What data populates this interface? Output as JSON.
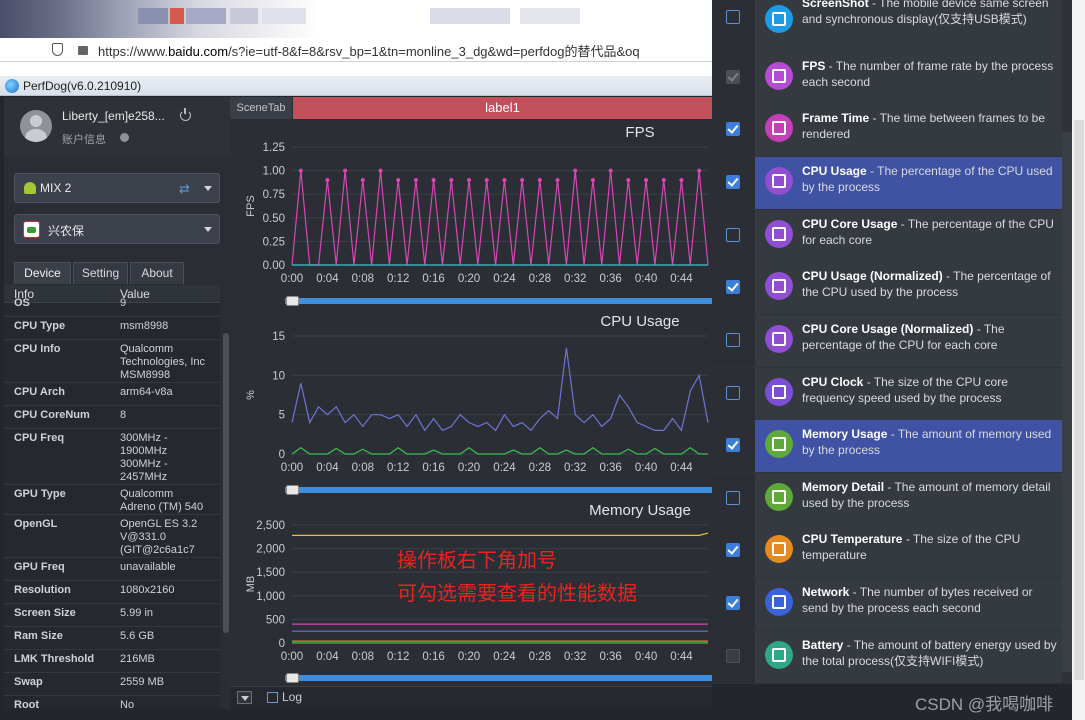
{
  "browser": {
    "url_prefix": "https://www.",
    "url_host": "baidu.com",
    "url_rest": "/s?ie=utf-8&f=8&rsv_bp=1&tn=monline_3_dg&wd=perfdog的替代品&oq"
  },
  "app": {
    "title": "PerfDog(v6.0.210910)"
  },
  "user": {
    "name": "Liberty_[em]e258...",
    "account_label": "账户信息"
  },
  "device": {
    "name": "MIX 2"
  },
  "target_app": {
    "name": "兴农保"
  },
  "tabs": [
    "Device",
    "Setting",
    "About"
  ],
  "info": {
    "headers": [
      "Info",
      "Value"
    ],
    "rows": [
      {
        "key": "OS",
        "value": "9"
      },
      {
        "key": "CPU Type",
        "value": "msm8998"
      },
      {
        "key": "CPU Info",
        "value": "Qualcomm\nTechnologies, Inc\nMSM8998"
      },
      {
        "key": "CPU Arch",
        "value": "arm64-v8a"
      },
      {
        "key": "CPU CoreNum",
        "value": "8"
      },
      {
        "key": "CPU Freq",
        "value": "300MHz -\n1900MHz\n300MHz -\n2457MHz"
      },
      {
        "key": "GPU Type",
        "value": "Qualcomm\nAdreno (TM) 540"
      },
      {
        "key": "OpenGL",
        "value": "OpenGL ES 3.2\nV@331.0\n(GIT@2c6a1c7"
      },
      {
        "key": "GPU Freq",
        "value": "unavailable"
      },
      {
        "key": "Resolution",
        "value": "1080x2160"
      },
      {
        "key": "Screen Size",
        "value": "5.99 in"
      },
      {
        "key": "Ram Size",
        "value": "5.6 GB"
      },
      {
        "key": "LMK Threshold",
        "value": "216MB"
      },
      {
        "key": "Swap",
        "value": "2559 MB"
      },
      {
        "key": "Root",
        "value": "No"
      }
    ]
  },
  "scene_tab": "SceneTab",
  "label": "label1",
  "chart_data": [
    {
      "type": "line",
      "title": "FPS",
      "ylabel": "FPS",
      "ylim": [
        0,
        1.25
      ],
      "yticks": [
        "0.00",
        "0.25",
        "0.50",
        "0.75",
        "1.00",
        "1.25"
      ],
      "xticks": [
        "0:00",
        "0:04",
        "0:08",
        "0:12",
        "0:16",
        "0:20",
        "0:24",
        "0:28",
        "0:32",
        "0:36",
        "0:40",
        "0:44"
      ],
      "x_seconds": [
        0,
        1,
        2,
        3,
        4,
        5,
        6,
        7,
        8,
        9,
        10,
        11,
        12,
        13,
        14,
        15,
        16,
        17,
        18,
        19,
        20,
        21,
        22,
        23,
        24,
        25,
        26,
        27,
        28,
        29,
        30,
        31,
        32,
        33,
        34,
        35,
        36,
        37,
        38,
        39,
        40,
        41,
        42,
        43,
        44,
        45,
        46,
        47
      ],
      "series": [
        {
          "color": "#d946b5",
          "values": [
            0,
            1,
            0,
            0,
            0.9,
            0,
            1,
            0,
            0.9,
            0,
            1,
            0,
            0.9,
            0,
            0.9,
            0,
            0.9,
            0,
            0.9,
            0,
            0.9,
            0,
            0.9,
            0,
            0.9,
            0,
            0.9,
            0,
            0.9,
            0,
            0.9,
            0,
            1,
            0,
            0.9,
            0,
            1,
            0,
            0.9,
            0,
            0.9,
            0,
            0.9,
            0,
            0.9,
            0,
            1,
            0
          ]
        },
        {
          "color": "#39c5cf",
          "values": [
            0,
            0,
            0,
            0,
            0,
            0,
            0,
            0,
            0,
            0,
            0,
            0,
            0,
            0,
            0,
            0,
            0,
            0,
            0,
            0,
            0,
            0,
            0,
            0,
            0,
            0,
            0,
            0,
            0,
            0,
            0,
            0,
            0,
            0,
            0,
            0,
            0,
            0,
            0,
            0,
            0,
            0,
            0,
            0,
            0,
            0,
            0,
            0
          ]
        }
      ]
    },
    {
      "type": "line",
      "title": "CPU Usage",
      "ylabel": "%",
      "ylim": [
        0,
        15
      ],
      "yticks": [
        "0",
        "5",
        "10",
        "15"
      ],
      "xticks": [
        "0:00",
        "0:04",
        "0:08",
        "0:12",
        "0:16",
        "0:20",
        "0:24",
        "0:28",
        "0:32",
        "0:36",
        "0:40",
        "0:44"
      ],
      "x_seconds": [
        0,
        1,
        2,
        3,
        4,
        5,
        6,
        7,
        8,
        9,
        10,
        11,
        12,
        13,
        14,
        15,
        16,
        17,
        18,
        19,
        20,
        21,
        22,
        23,
        24,
        25,
        26,
        27,
        28,
        29,
        30,
        31,
        32,
        33,
        34,
        35,
        36,
        37,
        38,
        39,
        40,
        41,
        42,
        43,
        44,
        45,
        46,
        47
      ],
      "series": [
        {
          "color": "#6e74d1",
          "values": [
            4,
            9,
            4,
            6,
            5,
            6,
            4,
            5,
            3.5,
            5,
            5,
            4.5,
            5,
            3.5,
            5,
            3,
            4.5,
            3,
            3.5,
            5,
            4,
            3.5,
            4,
            3,
            5,
            3.5,
            4,
            3,
            4.5,
            5.5,
            4.5,
            13.5,
            5,
            4,
            5,
            3.5,
            4.5,
            7.5,
            6,
            4,
            3.5,
            3,
            3,
            4.5,
            3,
            8,
            10,
            4
          ]
        },
        {
          "color": "#3fbf4f",
          "values": [
            0,
            0.8,
            0,
            0,
            0,
            0.7,
            0,
            0,
            0.6,
            0,
            0,
            0,
            0.8,
            0,
            0,
            0,
            0.5,
            0,
            0,
            0,
            0.8,
            0,
            0,
            0,
            0,
            0.5,
            0,
            0,
            0.8,
            0,
            0,
            0.5,
            0,
            0,
            0.8,
            0,
            0,
            0,
            0.6,
            0,
            0,
            0.7,
            0,
            0,
            0,
            0.8,
            0,
            0
          ]
        }
      ]
    },
    {
      "type": "line",
      "title": "Memory Usage",
      "ylabel": "MB",
      "ylim": [
        0,
        2500
      ],
      "yticks": [
        "0",
        "500",
        "1,000",
        "1,500",
        "2,000",
        "2,500"
      ],
      "xticks": [
        "0:00",
        "0:04",
        "0:08",
        "0:12",
        "0:16",
        "0:20",
        "0:24",
        "0:28",
        "0:32",
        "0:36",
        "0:40",
        "0:44"
      ],
      "x_seconds": [
        0,
        46,
        47
      ],
      "series": [
        {
          "color": "#e6c229",
          "values": [
            2280,
            2280,
            2330
          ]
        },
        {
          "color": "#d946b5",
          "values": [
            400,
            400,
            400
          ]
        },
        {
          "color": "#6e74d1",
          "values": [
            250,
            250,
            250
          ]
        },
        {
          "color": "#e08a3c",
          "values": [
            40,
            40,
            40
          ]
        },
        {
          "color": "#3fbf4f",
          "values": [
            0,
            0,
            0
          ]
        }
      ]
    }
  ],
  "notes": [
    "操作板右下角加号",
    "可勾选需要查看的性能数据"
  ],
  "log_label": "Log",
  "panel": {
    "items": [
      {
        "name": "ScreenShot",
        "desc": " - The mobile device same screen and synchronous display(仅支持USB模式)",
        "checked": false,
        "disabled": false,
        "selected": false,
        "icon_color": "#1e9be3"
      },
      {
        "name": "FPS",
        "desc": " - The number of frame rate by the process each second",
        "checked": true,
        "disabled": true,
        "selected": false,
        "icon_color": "#b64bd6"
      },
      {
        "name": "Frame Time",
        "desc": " - The time between frames to be rendered",
        "checked": true,
        "disabled": false,
        "selected": false,
        "icon_color": "#c43fb8"
      },
      {
        "name": "CPU Usage",
        "desc": " - The percentage of the CPU used by the process",
        "checked": true,
        "disabled": false,
        "selected": true,
        "icon_color": "#8f4fd0"
      },
      {
        "name": "CPU Core Usage",
        "desc": " - The percentage of the CPU for each core",
        "checked": false,
        "disabled": false,
        "selected": false,
        "icon_color": "#8f4fd0"
      },
      {
        "name": "CPU Usage (Normalized)",
        "desc": " - The percentage of the CPU used by the process",
        "checked": true,
        "disabled": false,
        "selected": false,
        "icon_color": "#8f4fd0"
      },
      {
        "name": "CPU Core Usage (Normalized)",
        "desc": " - The percentage of the CPU for each core",
        "checked": false,
        "disabled": false,
        "selected": false,
        "icon_color": "#8f4fd0"
      },
      {
        "name": "CPU Clock",
        "desc": " - The size of the CPU core frequency speed used by the process",
        "checked": false,
        "disabled": false,
        "selected": false,
        "icon_color": "#7a4fd6"
      },
      {
        "name": "Memory Usage",
        "desc": " - The amount of memory used by the process",
        "checked": true,
        "disabled": false,
        "selected": true,
        "icon_color": "#5fa83a"
      },
      {
        "name": "Memory Detail",
        "desc": " - The amount of memory detail used by the process",
        "checked": false,
        "disabled": false,
        "selected": false,
        "icon_color": "#5fa83a"
      },
      {
        "name": "CPU Temperature",
        "desc": " - The size of the CPU temperature",
        "checked": true,
        "disabled": false,
        "selected": false,
        "icon_color": "#e48a1f"
      },
      {
        "name": "Network",
        "desc": " - The number of bytes received or send by the process each second",
        "checked": true,
        "disabled": false,
        "selected": false,
        "icon_color": "#3a63d9"
      },
      {
        "name": "Battery",
        "desc": " - The amount of battery energy used by the total process(仅支持WIFI模式)",
        "checked": false,
        "disabled": true,
        "selected": false,
        "icon_color": "#2ea886"
      }
    ]
  },
  "watermark": "CSDN @我喝咖啡"
}
